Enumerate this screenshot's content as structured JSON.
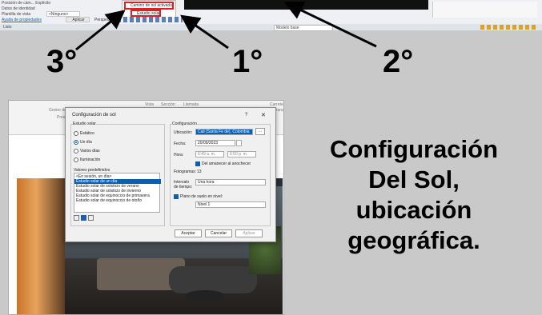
{
  "top_strip": {
    "properties": [
      {
        "label": "Posición de cám... Explícito",
        "value": ""
      },
      {
        "label": "Datos de identidad",
        "value": ""
      },
      {
        "label": "Plantilla de vista",
        "value": "<Ninguno>"
      },
      {
        "label": "Ayuda de propiedades",
        "value": "Aplicar"
      }
    ],
    "sun_menu": {
      "item1": "Camino de sol activado",
      "item2": "Estudio solar"
    },
    "status_left": "Listo",
    "status_scale": "Perspectiva",
    "status_model": "Modelo base"
  },
  "annotations": {
    "n1": "1°",
    "n2": "2°",
    "n3": "3°"
  },
  "ribbon": {
    "tab1": "Vista",
    "tab2": "Sección",
    "tab3": "Llamada",
    "g1": "Gestor de v",
    "g2": "Presentación",
    "g3": "Carrete",
    "g4": "ventana"
  },
  "dialog": {
    "title": "Configuración de sol",
    "help": "?",
    "close": "✕",
    "study_title": "Estudio solar",
    "radio_static": "Estático",
    "radio_oneday": "Un día",
    "radio_multiday": "Varios días",
    "radio_light": "Iluminación",
    "presets_title": "Valores predefinidos",
    "presets": [
      "<En sesión, un día>",
      "Estudio solar de un día",
      "Estudio solar de solsticio de verano",
      "Estudio solar de solsticio de invierno",
      "Estudio solar de equinoccio de primavera",
      "Estudio solar de equinoccio de otoño"
    ],
    "config_title": "Configuración",
    "location_label": "Ubicación:",
    "location_value": "Cali (Santa Fe de), Colombia",
    "location_btn": "...",
    "date_label": "Fecha:",
    "date_value": "20/09/2023",
    "time_label": "Hora:",
    "time_from": "6:49 a. m.",
    "time_to": "6:50 p. m.",
    "sun_checkbox": "Del amanecer al anochecer",
    "frames_label": "Fotogramas:",
    "frames_value": "13",
    "interval_label": "Intervalo de tiempo:",
    "interval_value": "Una hora",
    "ground_checkbox": "Plano de suelo en nivel:",
    "level_value": "Nivel 1",
    "ok": "Aceptar",
    "cancel": "Cancelar",
    "apply": "Aplicar"
  },
  "heading": {
    "line1": "Configuración",
    "line2": "Del Sol,",
    "line3": "ubicación",
    "line4": "geográfica."
  },
  "colors": {
    "arrow": "#000000",
    "highlight_red": "#e02020",
    "selection_blue": "#0a5fb4"
  }
}
